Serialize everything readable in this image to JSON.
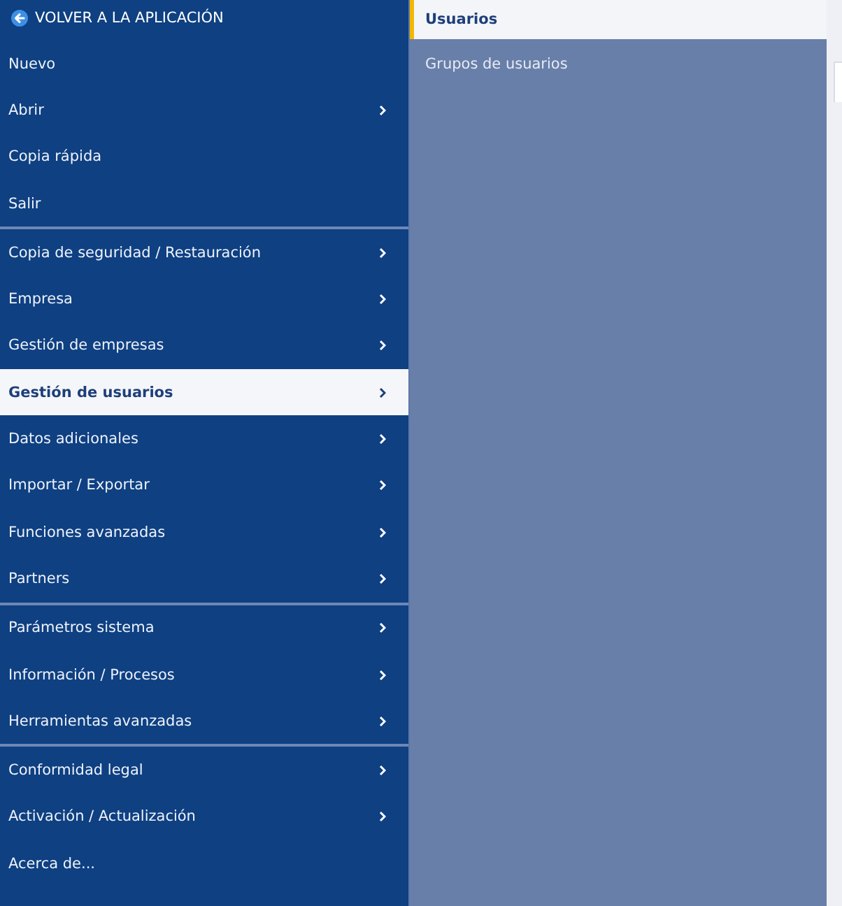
{
  "back_link": {
    "label": "VOLVER A LA APLICACIÓN"
  },
  "menu": {
    "groups": [
      {
        "items": [
          {
            "label": "Nuevo",
            "has_submenu": false,
            "selected": false
          },
          {
            "label": "Abrir",
            "has_submenu": true,
            "selected": false
          },
          {
            "label": "Copia rápida",
            "has_submenu": false,
            "selected": false
          },
          {
            "label": "Salir",
            "has_submenu": false,
            "selected": false
          }
        ]
      },
      {
        "items": [
          {
            "label": "Copia de seguridad / Restauración",
            "has_submenu": true,
            "selected": false
          },
          {
            "label": "Empresa",
            "has_submenu": true,
            "selected": false
          },
          {
            "label": "Gestión de empresas",
            "has_submenu": true,
            "selected": false
          },
          {
            "label": "Gestión de usuarios",
            "has_submenu": true,
            "selected": true
          },
          {
            "label": "Datos adicionales",
            "has_submenu": true,
            "selected": false
          },
          {
            "label": "Importar / Exportar",
            "has_submenu": true,
            "selected": false
          },
          {
            "label": "Funciones avanzadas",
            "has_submenu": true,
            "selected": false
          },
          {
            "label": "Partners",
            "has_submenu": true,
            "selected": false
          }
        ]
      },
      {
        "items": [
          {
            "label": "Parámetros sistema",
            "has_submenu": true,
            "selected": false
          },
          {
            "label": "Información / Procesos",
            "has_submenu": true,
            "selected": false
          },
          {
            "label": "Herramientas avanzadas",
            "has_submenu": true,
            "selected": false
          }
        ]
      },
      {
        "items": [
          {
            "label": "Conformidad legal",
            "has_submenu": true,
            "selected": false
          },
          {
            "label": "Activación / Actualización",
            "has_submenu": true,
            "selected": false
          },
          {
            "label": "Acerca de...",
            "has_submenu": false,
            "selected": false
          }
        ]
      }
    ]
  },
  "submenu": {
    "items": [
      {
        "label": "Usuarios",
        "selected": true
      },
      {
        "label": "Grupos de usuarios",
        "selected": false
      }
    ]
  }
}
